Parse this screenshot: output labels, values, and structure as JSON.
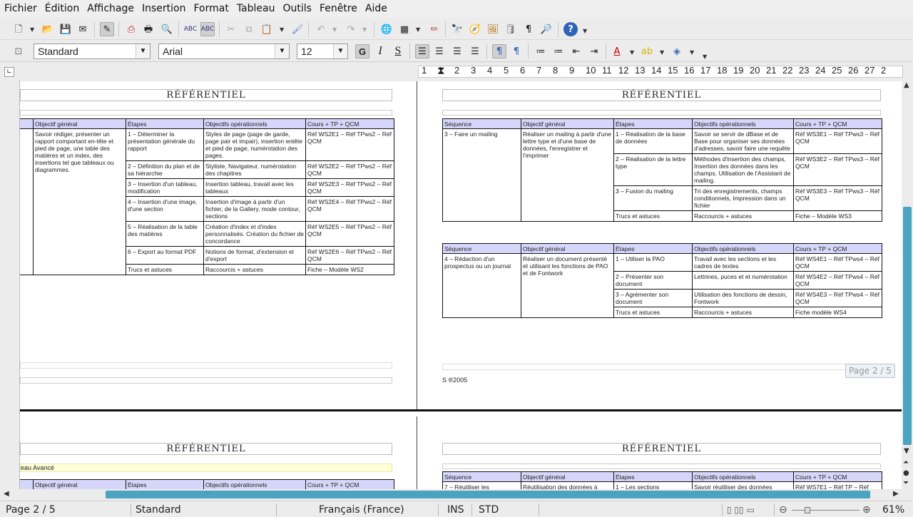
{
  "menu": [
    "Fichier",
    "Édition",
    "Affichage",
    "Insertion",
    "Format",
    "Tableau",
    "Outils",
    "Fenêtre",
    "Aide"
  ],
  "format_bar": {
    "style": "Standard",
    "font": "Arial",
    "size": "12",
    "bold": "G",
    "italic": "I",
    "underline": "S"
  },
  "ruler": {
    "marks": [
      "1",
      "1",
      "2",
      "3",
      "4",
      "5",
      "6",
      "7",
      "8",
      "9",
      "10",
      "11",
      "12",
      "13",
      "14",
      "15",
      "16",
      "17",
      "18",
      "19",
      "20",
      "21",
      "22",
      "23",
      "24",
      "25",
      "26",
      "27",
      "2"
    ]
  },
  "header_title": "RÉFÉRENTIEL",
  "page_badge": "Page 2 / 5",
  "page_left": {
    "cols": [
      "Objectif général",
      "Étapes",
      "Objectifs opérationnels",
      "Cours + TP + QCM"
    ],
    "objectif": "Savoir rédiger, présenter un rapport comportant en-tête et pied de page, une table des matières et un index, des insertions tel que tableaux ou diagrammes.",
    "rows": [
      [
        "1 – Déterminer la présentation générale du rapport",
        "Styles de page (page de garde, page pair et impair), insertion entête et pied de page, numérotation des pages.",
        "Réf WS2E1 – Réf TPws2 – Réf QCM"
      ],
      [
        "2 – Définition du plan et de sa hiérarchie",
        "Styliste, Navigateur, numérotation des chapitres",
        "Réf WS2E2 – Réf TPws2 – Réf QCM"
      ],
      [
        "3 – Insertion d'un tableau, modification",
        "Insertion tableau, travail avec les tableaux",
        "Réf WS2E3 – Réf TPws2 – Réf QCM"
      ],
      [
        "4 – Insertion d'une image, d'une section",
        "Insertion d'image à partir d'un fichier, de la Gallery, mode contour, sections",
        "Réf WS2E4 – Réf TPws2 – Réf QCM"
      ],
      [
        "5 – Réalisation de la table des matières",
        "Création d'index et d'index personnalisés. Création du fichier de concordance",
        "Réf WS2E5 – Réf TPws2 – Réf QCM"
      ],
      [
        "6 – Export au format PDF",
        "Notions de format, d'extension et d'export",
        "Réf WS2E6 – Réf TPws2 – Réf QCM"
      ],
      [
        "Trucs et astuces",
        "Raccourcis + astuces",
        "Fiche – Modèle WS2"
      ]
    ]
  },
  "page_right": {
    "cols": [
      "Séquence",
      "Objectif général",
      "Étapes",
      "Objectifs opérationnels",
      "Cours + TP + QCM"
    ],
    "t1": {
      "seq": "3 – Faire un mailing",
      "obj": "Réaliser un mailing à partir d'une lettre type et d'une base de données, l'enregistrer et l'imprimer",
      "rows": [
        [
          "1 – Réalisation de la base de données",
          "Savoir se servir de dBase et de Base pour organiser ses données d'adresses, savoir faire une requête",
          "Réf WS3E1 – Réf TPws3 – Réf QCM"
        ],
        [
          "2 – Réalisation de la lettre type",
          "Méthodes d'insertion des champs, Insertion des données dans les champs. Utilisation de l'Assistant de mailing.",
          "Réf WS3E2 – Réf TPws3 – Réf QCM"
        ],
        [
          "3 – Fusion du mailing",
          "Tri des enregistrements, champs conditionnels, Impression dans un fichier",
          "Réf WS3E3 – Réf TPws3 – Réf QCM"
        ],
        [
          "Trucs et astuces",
          "Raccourcis + astuces",
          "Fiche – Modèle WS3"
        ]
      ]
    },
    "t2": {
      "seq": "4 – Rédaction d'un prospectus ou un journal",
      "obj": "Réaliser un document présenté et utilisant les fonctions de PAO et de Fontwork",
      "rows": [
        [
          "1 – Utiliser la PAO",
          "Travail avec les sections et les cadres de textes",
          "Réf WS4E1 – Réf TPws4 – Réf QCM"
        ],
        [
          "2 – Présenter son document",
          "Lettrines, puces et et numérotation",
          "Réf WS4E2 – Réf TPws4 – Réf QCM"
        ],
        [
          "3 – Agrémenter son document",
          "Utilisation des fonctions de dessin, Fontwork",
          "Réf WS4E3 – Réf TPws4 – Réf QCM"
        ],
        [
          "Trucs et astuces",
          "Raccourcis + astuces",
          "Fiche modèle WS4"
        ]
      ]
    },
    "footer": "S ®2005"
  },
  "page3": {
    "banner": "eau Avancé",
    "cols": [
      "Objectif général",
      "Étapes",
      "Objectifs opérationnels",
      "Cours + TP + QCM"
    ]
  },
  "page4": {
    "cols": [
      "Séquence",
      "Objectif général",
      "Étapes",
      "Objectifs opérationnels",
      "Cours + TP + QCM"
    ],
    "partial": [
      "7 – Réutiliser les",
      "Réutilisation des données à",
      "1 – Les sections",
      "Savoir réutiliser des données",
      "Réf WS7E1 – Réf TP – Réf"
    ]
  },
  "status": {
    "page": "Page 2 / 5",
    "style": "Standard",
    "language": "Français (France)",
    "mode": "INS",
    "sel": "STD",
    "zoom": "61%"
  },
  "accent": "#4aa3bf",
  "header_fill": "#d6d6fa"
}
